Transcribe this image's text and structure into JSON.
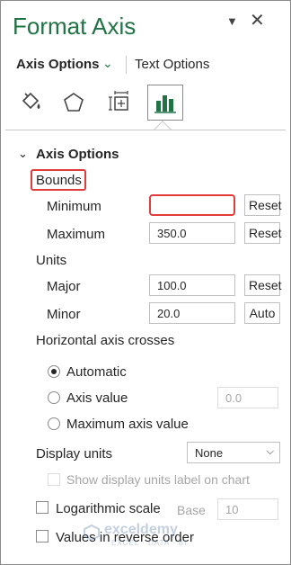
{
  "pane": {
    "title": "Format Axis"
  },
  "tabs": {
    "axis_options": "Axis Options",
    "text_options": "Text Options"
  },
  "icons": [
    "fill-line-icon",
    "effects-icon",
    "size-properties-icon",
    "axis-options-icon"
  ],
  "section": {
    "title": "Axis Options"
  },
  "bounds": {
    "label": "Bounds",
    "minimum_label": "Minimum",
    "minimum_value": "",
    "minimum_button": "Reset",
    "maximum_label": "Maximum",
    "maximum_value": "350.0",
    "maximum_button": "Reset"
  },
  "units": {
    "label": "Units",
    "major_label": "Major",
    "major_value": "100.0",
    "major_button": "Reset",
    "minor_label": "Minor",
    "minor_value": "20.0",
    "minor_button": "Auto"
  },
  "crosses": {
    "label": "Horizontal axis crosses",
    "automatic": "Automatic",
    "axis_value": "Axis value",
    "axis_value_input": "0.0",
    "maximum_axis_value": "Maximum axis value",
    "selected": "automatic"
  },
  "display_units": {
    "label": "Display units",
    "selected": "None",
    "show_label": "Show display units label on chart"
  },
  "log_scale": {
    "label": "Logarithmic scale",
    "base_label": "Base",
    "base_value": "10"
  },
  "reverse_order": {
    "label": "Values in reverse order"
  },
  "watermark": {
    "name": "exceldemy",
    "tagline": "EXCEL · DATA · BI"
  },
  "colors": {
    "title_green": "#217346",
    "highlight_red": "#e23b3b",
    "chart_icon_green": "#217346"
  }
}
